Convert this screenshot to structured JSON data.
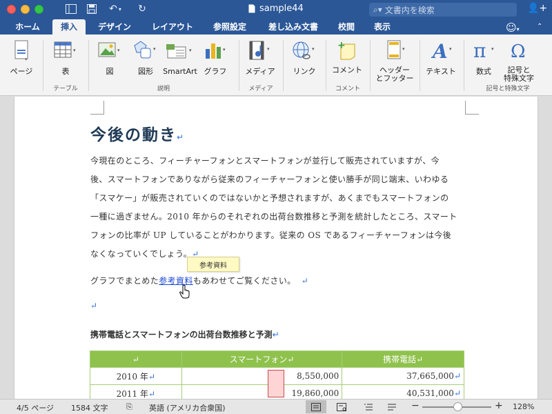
{
  "window": {
    "title": "sample44",
    "search_placeholder": "文書内を検索"
  },
  "tabs": [
    {
      "label": "ホーム",
      "active": false
    },
    {
      "label": "挿入",
      "active": true
    },
    {
      "label": "デザイン",
      "active": false
    },
    {
      "label": "レイアウト",
      "active": false
    },
    {
      "label": "参照設定",
      "active": false
    },
    {
      "label": "差し込み文書",
      "active": false
    },
    {
      "label": "校閲",
      "active": false
    },
    {
      "label": "表示",
      "active": false
    }
  ],
  "ribbon": {
    "buttons": {
      "page": "ページ",
      "table": "表",
      "picture": "図",
      "shapes": "図形",
      "smartart": "SmartArt",
      "chart": "グラフ",
      "media": "メディア",
      "link": "リンク",
      "comment": "コメント",
      "header_footer_1": "ヘッダー",
      "header_footer_2": "とフッター",
      "text": "テキスト",
      "equation": "数式",
      "symbol_1": "記号と",
      "symbol_2": "特殊文字"
    },
    "groups": {
      "table": "テーブル",
      "illustrations": "説明",
      "media": "メディア",
      "comments": "コメント",
      "symbols": "記号と特殊文字"
    }
  },
  "document": {
    "heading": "今後の動き",
    "paragraph_lines": [
      "今現在のところ、フィーチャーフォンとスマートフォンが並行して販売されていますが、今",
      "後、スマートフォンでありながら従来のフィーチャーフォンと使い勝手が同じ端末、いわゆる",
      "「スマケー」が販売されていくのではないかと予想されますが、あくまでもスマートフォンの",
      "一種に過ぎません。2010 年からのそれぞれの出荷台数推移と予測を統計したところ、スマート",
      "フォンの比率が UP していることがわかります。従来の OS であるフィーチャーフォンは今後",
      "なくなっていくでしょう。"
    ],
    "link_sentence_before": "グラフでまとめた",
    "link_text": "参考資料",
    "link_sentence_after": "もあわせてご覧ください。",
    "tooltip": "参考資料",
    "table_caption": "携帯電話とスマートフォンの出荷台数推移と予測",
    "table": {
      "headers": [
        "",
        "スマートフォン",
        "携帯電話"
      ],
      "rows": [
        [
          "2010 年",
          "8,550,000",
          "37,665,000"
        ],
        [
          "2011 年",
          "19,860,000",
          "40,531,000"
        ]
      ]
    }
  },
  "status": {
    "page": "4/5 ページ",
    "words": "1584 文字",
    "language": "英語 (アメリカ合衆国)",
    "zoom_minus": "−",
    "zoom_plus": "+",
    "zoom": "128%"
  }
}
